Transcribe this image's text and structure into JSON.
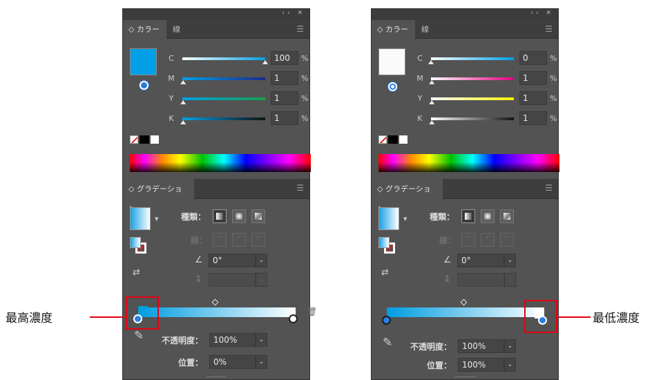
{
  "left_panel": {
    "color_panel": {
      "title_bar_icons": "‹‹ ✕",
      "tab_label": "◇ カラー",
      "tab2_label": "線",
      "menu_icon": "☰",
      "fill_color": "#009fe8",
      "rows": [
        {
          "label": "C",
          "value": "100",
          "unit": "%",
          "gradient": "linear-gradient(to right, #ffffff, #00a0e9)",
          "level": 1.0
        },
        {
          "label": "M",
          "value": "1",
          "unit": "%",
          "gradient": "linear-gradient(to right, #00a0e9, #1a2a8a)",
          "level": 0.01
        },
        {
          "label": "Y",
          "value": "1",
          "unit": "%",
          "gradient": "linear-gradient(to right, #00a0e9, #18a04a)",
          "level": 0.01
        },
        {
          "label": "K",
          "value": "1",
          "unit": "%",
          "gradient": "linear-gradient(to right, #00a0e9, #111111)",
          "level": 0.01
        }
      ]
    },
    "gradient_panel": {
      "tab_label": "◇ グラデーション",
      "menu_icon": "☰",
      "type_label": "種類：",
      "stroke_label": "線：",
      "angle_value": "0°",
      "opacity_label": "不透明度：",
      "opacity_value": "100%",
      "location_label": "位置：",
      "location_value": "0%",
      "selected_stop": "left"
    }
  },
  "right_panel": {
    "color_panel": {
      "title_bar_icons": "‹‹ ✕",
      "tab_label": "◇ カラー",
      "tab2_label": "線",
      "menu_icon": "☰",
      "fill_color": "#fafafa",
      "rows": [
        {
          "label": "C",
          "value": "0",
          "unit": "%",
          "gradient": "linear-gradient(to right, #ffffff, #00a0e9)",
          "level": 0.0
        },
        {
          "label": "M",
          "value": "1",
          "unit": "%",
          "gradient": "linear-gradient(to right, #ffffff, #e4007f)",
          "level": 0.01
        },
        {
          "label": "Y",
          "value": "1",
          "unit": "%",
          "gradient": "linear-gradient(to right, #ffffff, #fff100)",
          "level": 0.01
        },
        {
          "label": "K",
          "value": "1",
          "unit": "%",
          "gradient": "linear-gradient(to right, #ffffff, #111111)",
          "level": 0.01
        }
      ]
    },
    "gradient_panel": {
      "tab_label": "◇ グラデーション",
      "menu_icon": "☰",
      "type_label": "種類：",
      "stroke_label": "線：",
      "angle_value": "0°",
      "opacity_label": "不透明度：",
      "opacity_value": "100%",
      "location_label": "位置：",
      "location_value": "100%",
      "selected_stop": "right"
    }
  },
  "annotations": {
    "left_label": "最高濃度",
    "right_label": "最低濃度",
    "color": "#e60012"
  },
  "icons": {
    "eyedropper": "✎",
    "trash": "🗑",
    "angle": "∠",
    "aspect": "↨",
    "reverse": "⇄",
    "dropdown": "⌄"
  }
}
